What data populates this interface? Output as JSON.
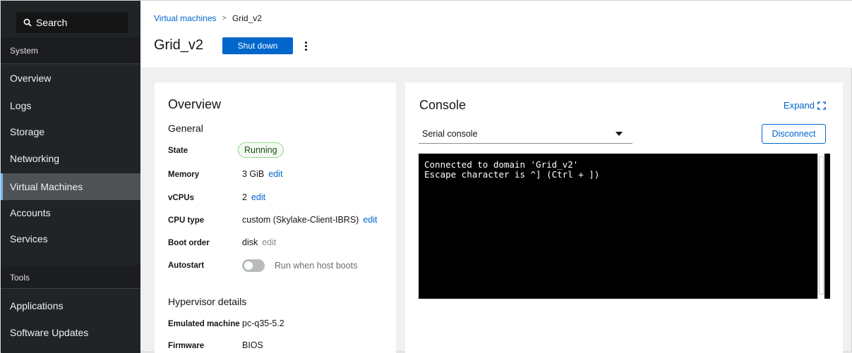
{
  "sidebar": {
    "search_label": "Search",
    "section_system": "System",
    "items": [
      "Overview",
      "Logs",
      "Storage",
      "Networking",
      "Virtual Machines",
      "Accounts",
      "Services"
    ],
    "active_item": "Virtual Machines",
    "section_tools": "Tools",
    "tools_items": [
      "Applications",
      "Software Updates"
    ]
  },
  "header": {
    "breadcrumb_parent": "Virtual machines",
    "breadcrumb_separator": ">",
    "breadcrumb_current": "Grid_v2",
    "title": "Grid_v2",
    "shutdown_label": "Shut down"
  },
  "overview": {
    "title": "Overview",
    "general_heading": "General",
    "state_label": "State",
    "state_value": "Running",
    "memory_label": "Memory",
    "memory_value": "3 GiB",
    "vcpus_label": "vCPUs",
    "vcpus_value": "2",
    "cputype_label": "CPU type",
    "cputype_value": "custom (Skylake-Client-IBRS)",
    "bootorder_label": "Boot order",
    "bootorder_value": "disk",
    "autostart_label": "Autostart",
    "autostart_text": "Run when host boots",
    "edit_label": "edit",
    "hypervisor_heading": "Hypervisor details",
    "emulated_label": "Emulated machine",
    "emulated_value": "pc-q35-5.2",
    "firmware_label": "Firmware",
    "firmware_value": "BIOS"
  },
  "console": {
    "title": "Console",
    "expand_label": "Expand",
    "console_type": "Serial console",
    "disconnect_label": "Disconnect",
    "lines": [
      "Connected to domain 'Grid_v2'",
      "Escape character is ^] (Ctrl + ])"
    ]
  },
  "colors": {
    "sidebar_bg": "#212427",
    "primary": "#0066cc",
    "active_indicator": "#73bcf7",
    "running_badge_border": "#95d58e"
  }
}
